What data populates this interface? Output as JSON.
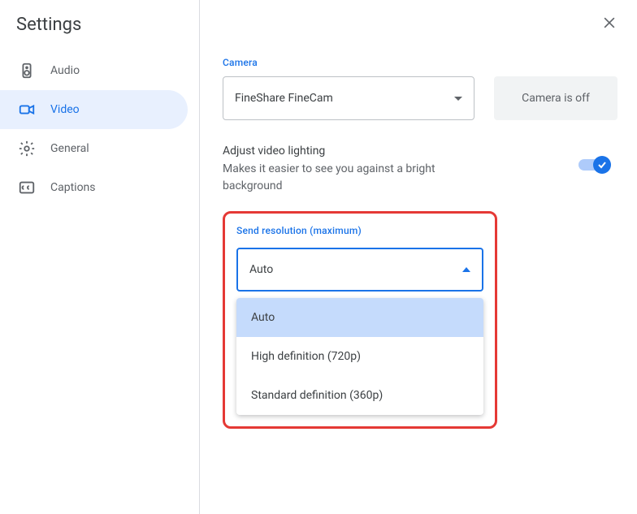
{
  "page_title": "Settings",
  "sidebar": {
    "items": [
      {
        "label": "Audio",
        "icon": "speaker"
      },
      {
        "label": "Video",
        "icon": "video"
      },
      {
        "label": "General",
        "icon": "gear"
      },
      {
        "label": "Captions",
        "icon": "cc"
      }
    ],
    "active_index": 1
  },
  "camera": {
    "label": "Camera",
    "selected": "FineShare FineCam",
    "preview_text": "Camera is off"
  },
  "lighting": {
    "title": "Adjust video lighting",
    "desc": "Makes it easier to see you against a bright background",
    "enabled": true
  },
  "send_resolution": {
    "label": "Send resolution (maximum)",
    "selected": "Auto",
    "options": [
      "Auto",
      "High definition (720p)",
      "Standard definition (360p)"
    ],
    "selected_index": 0
  }
}
